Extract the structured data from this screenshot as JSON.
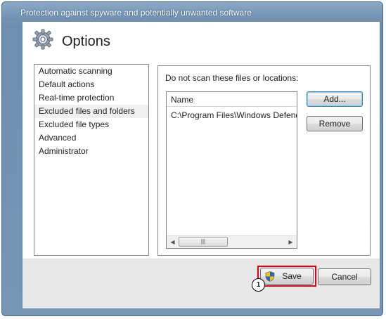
{
  "window": {
    "title": "Protection against spyware and potentially unwanted software"
  },
  "header": {
    "title": "Options",
    "icon": "gear-icon"
  },
  "sidebar": {
    "items": [
      {
        "label": "Automatic scanning",
        "selected": false
      },
      {
        "label": "Default actions",
        "selected": false
      },
      {
        "label": "Real-time protection",
        "selected": false
      },
      {
        "label": "Excluded files and folders",
        "selected": true
      },
      {
        "label": "Excluded file types",
        "selected": false
      },
      {
        "label": "Advanced",
        "selected": false
      },
      {
        "label": "Administrator",
        "selected": false
      }
    ]
  },
  "content": {
    "label": "Do not scan these files or locations:",
    "list": {
      "column_header": "Name",
      "rows": [
        "C:\\Program Files\\Windows Defender"
      ],
      "scroll_left_icon": "◀",
      "scroll_right_icon": "▶",
      "scroll_grip": "|||"
    },
    "add_label": "Add...",
    "remove_label": "Remove"
  },
  "footer": {
    "save_label": "Save",
    "cancel_label": "Cancel",
    "save_icon": "uac-shield-icon",
    "callout_number": "1",
    "highlight_color": "#e0001b"
  }
}
